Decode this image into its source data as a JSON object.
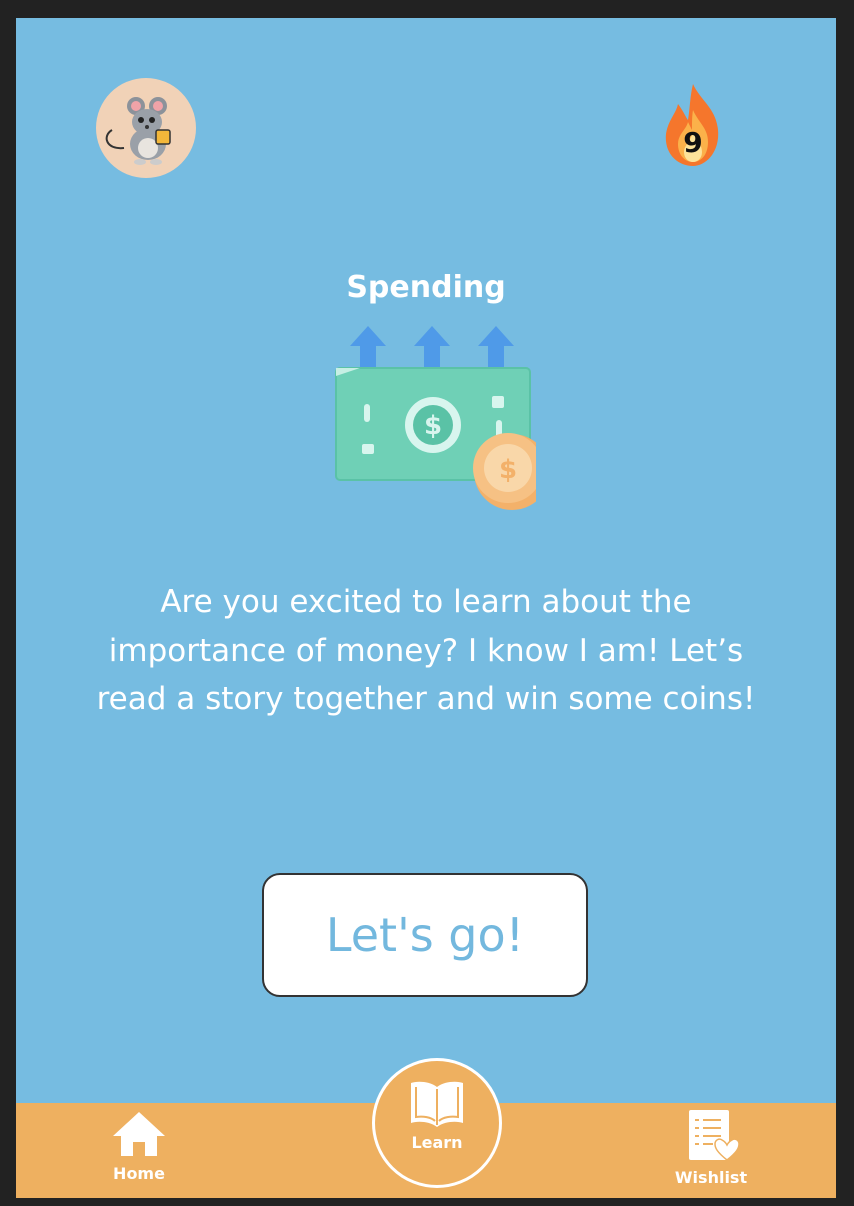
{
  "header": {
    "avatar_icon": "mouse-avatar-icon",
    "streak_icon": "fire-icon",
    "streak_count": "9"
  },
  "lesson": {
    "topic_title": "Spending",
    "illustration_icon": "money-spending-icon",
    "message": "Are you excited to learn about the importance of money? I know I am! Let’s read a story together and win some coins!",
    "cta_label": "Let's go!"
  },
  "nav": {
    "home_label": "Home",
    "learn_label": "Learn",
    "wishlist_label": "Wishlist"
  },
  "colors": {
    "background": "#76bce1",
    "navbar": "#eeb060",
    "cta_text": "#73b8de",
    "bill": "#6fd0b6",
    "coin": "#f6bf7a",
    "arrows": "#4f9ae8"
  }
}
